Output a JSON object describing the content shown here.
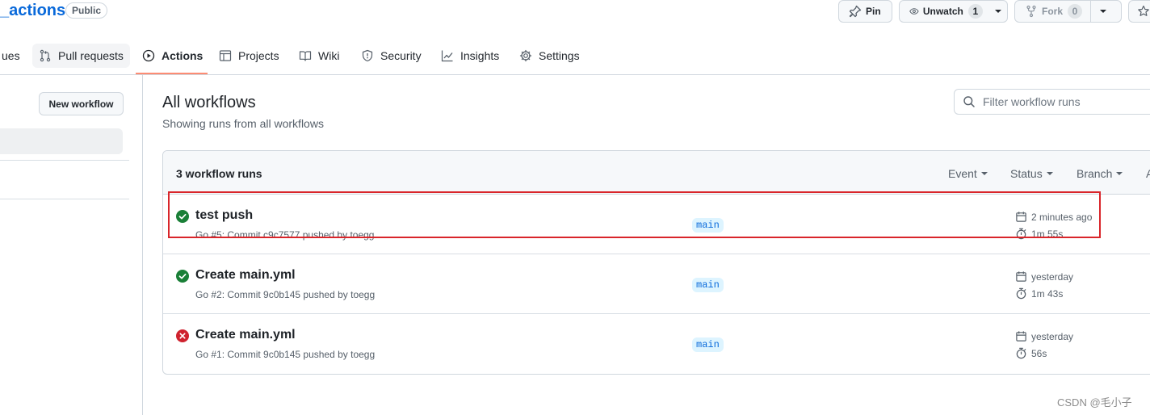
{
  "header": {
    "repo_name": "_actions",
    "visibility": "Public",
    "pin_label": "Pin",
    "unwatch_label": "Unwatch",
    "watch_count": "1",
    "fork_label": "Fork",
    "fork_count": "0"
  },
  "tabs": [
    {
      "label": "ues",
      "icon": "issue-icon"
    },
    {
      "label": "Pull requests",
      "icon": "pull-request-icon"
    },
    {
      "label": "Actions",
      "icon": "play-icon",
      "selected": true
    },
    {
      "label": "Projects",
      "icon": "table-icon"
    },
    {
      "label": "Wiki",
      "icon": "book-icon"
    },
    {
      "label": "Security",
      "icon": "shield-icon"
    },
    {
      "label": "Insights",
      "icon": "graph-icon"
    },
    {
      "label": "Settings",
      "icon": "gear-icon"
    }
  ],
  "sidebar": {
    "new_workflow_label": "New workflow"
  },
  "main": {
    "title": "All workflows",
    "subtitle": "Showing runs from all workflows",
    "filter_placeholder": "Filter workflow runs"
  },
  "runs": {
    "count_label": "3 workflow runs",
    "filters": [
      "Event",
      "Status",
      "Branch",
      "A"
    ],
    "items": [
      {
        "title": "test push",
        "meta": "Go #5: Commit c9c7577 pushed by toegg",
        "branch": "main",
        "when": "2 minutes ago",
        "duration": "1m 55s",
        "status": "success"
      },
      {
        "title": "Create main.yml",
        "meta": "Go #2: Commit 9c0b145 pushed by toegg",
        "branch": "main",
        "when": "yesterday",
        "duration": "1m 43s",
        "status": "success"
      },
      {
        "title": "Create main.yml",
        "meta": "Go #1: Commit 9c0b145 pushed by toegg",
        "branch": "main",
        "when": "yesterday",
        "duration": "56s",
        "status": "failure"
      }
    ]
  },
  "colors": {
    "success": "#1a7f37",
    "failure": "#cf222e",
    "accent": "#0969da",
    "tab_underline": "#fd8c73",
    "highlight": "#d9252a"
  },
  "watermark": "CSDN @毛小子"
}
